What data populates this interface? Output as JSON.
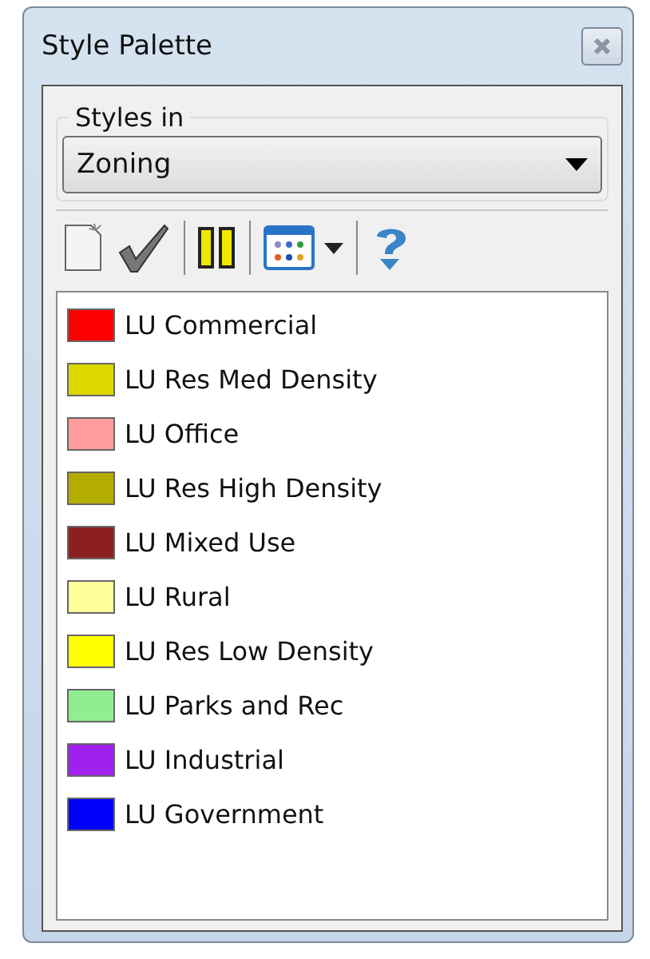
{
  "window": {
    "title": "Style Palette"
  },
  "group": {
    "label": "Styles in",
    "value": "Zoning"
  },
  "styles": [
    {
      "name": "LU Commercial",
      "color": "#ff0000"
    },
    {
      "name": "LU Res Med Density",
      "color": "#dcd800"
    },
    {
      "name": "LU Office",
      "color": "#ff9c9c"
    },
    {
      "name": "LU Res High Density",
      "color": "#b4ac00"
    },
    {
      "name": "LU Mixed Use",
      "color": "#8c2020"
    },
    {
      "name": "LU Rural",
      "color": "#ffff9c"
    },
    {
      "name": "LU Res Low Density",
      "color": "#ffff00"
    },
    {
      "name": "LU Parks and Rec",
      "color": "#90ee90"
    },
    {
      "name": "LU Industrial",
      "color": "#a020f0"
    },
    {
      "name": "LU Government",
      "color": "#0000ff"
    }
  ]
}
